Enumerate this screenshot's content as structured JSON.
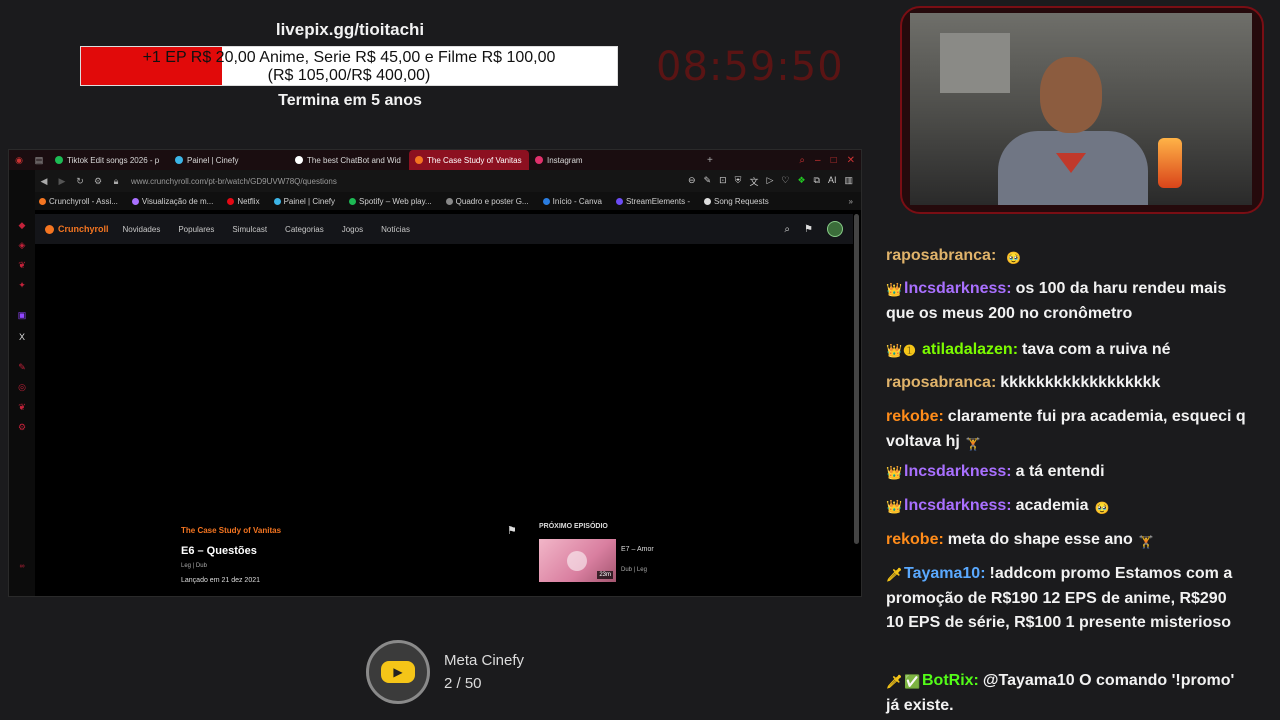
{
  "overlay": {
    "goal_link": "livepix.gg/tioitachi",
    "goal_text_line1": "+1 EP R$ 20,00 Anime, Serie R$ 45,00 e Filme R$ 100,00",
    "goal_text_line2": "(R$ 105,00/R$ 400,00)",
    "goal_progress_fraction": 0.2625,
    "goal_end": "Termina em 5 anos",
    "timer": "08:59:50",
    "colors": {
      "fill": "#e10a0a",
      "timer": "#5a1414"
    }
  },
  "browser": {
    "tabs": [
      {
        "label": "Tiktok Edit songs 2026 - p",
        "icon": "spotify-icon"
      },
      {
        "label": "Painel | Cinefy",
        "icon": "cinefy-icon"
      },
      {
        "label": "The best ChatBot and Wid",
        "icon": "bot-icon"
      },
      {
        "label": "The Case Study of Vanitas",
        "icon": "crunchyroll-icon",
        "active": true
      },
      {
        "label": "Instagram",
        "icon": "instagram-icon"
      }
    ],
    "url": "www.crunchyroll.com/pt-br/watch/GD9UVW78Q/questions",
    "bookmarks": [
      "Crunchyroll - Assi...",
      "Visualização de m...",
      "Netflix",
      "Painel | Cinefy",
      "Spotify – Web play...",
      "Quadro e poster G...",
      "Início - Canva",
      "StreamElements -",
      "Song Requests"
    ],
    "crunchyroll": {
      "logo": "Crunchyroll",
      "nav": [
        "Novidades",
        "Populares",
        "Simulcast",
        "Categorias",
        "Jogos",
        "Notícias"
      ],
      "series": "The Case Study of Vanitas",
      "episode_title": "E6 – Questões",
      "episode_meta": "Leg | Dub",
      "episode_date": "Lançado em 21 dez 2021",
      "next_label": "PRÓXIMO EPISÓDIO",
      "next_title": "E7 – Amor",
      "next_meta": "Dub | Leg",
      "next_duration": "23m"
    }
  },
  "meta_goal": {
    "title": "Meta Cinefy",
    "count": "2 / 50"
  },
  "chat": [
    {
      "user": "raposabranca:",
      "color": "#e0b36a",
      "badges": [],
      "text": "",
      "emote": "🥹"
    },
    {
      "user": "lncsdarkness:",
      "color": "#a970ff",
      "badges": [
        "👑"
      ],
      "text": "os 100 da haru rendeu mais que os meus 200 no cronômetro"
    },
    {
      "user": "atiladalazen:",
      "color": "#7cfc00",
      "badges": [
        "👑",
        "➊"
      ],
      "text": "tava com a ruiva né"
    },
    {
      "user": "raposabranca:",
      "color": "#e0b36a",
      "badges": [],
      "text": "kkkkkkkkkkkkkkkkkk"
    },
    {
      "user": "rekobe:",
      "color": "#ff8c1a",
      "badges": [],
      "text": "claramente fui pra academia, esqueci q voltava hj",
      "emote": "🏋"
    },
    {
      "user": "lncsdarkness:",
      "color": "#a970ff",
      "badges": [
        "👑"
      ],
      "text": "a tá entendi"
    },
    {
      "user": "lncsdarkness:",
      "color": "#a970ff",
      "badges": [
        "👑"
      ],
      "text": "academia",
      "emote": "🥹"
    },
    {
      "user": "rekobe:",
      "color": "#ff8c1a",
      "badges": [],
      "text": "meta do shape esse ano",
      "emote": "🏋"
    },
    {
      "user": "Tayama10:",
      "color": "#5aa9ff",
      "badges": [
        "🗡"
      ],
      "text": "!addcom promo Estamos com a promoção de R$190 12 EPS de anime, R$290 10 EPS de série, R$100 1 presente misterioso"
    },
    {
      "user": "BotRix:",
      "color": "#53fc18",
      "badges": [
        "🗡",
        "✅"
      ],
      "text": "@Tayama10 O comando '!promo' já existe."
    }
  ]
}
